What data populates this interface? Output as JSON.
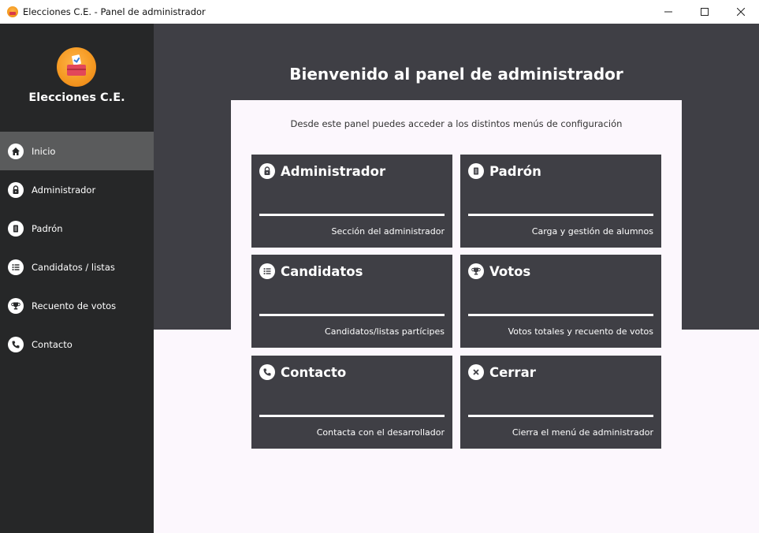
{
  "window": {
    "title": "Elecciones C.E. - Panel de administrador",
    "controls": [
      "minimize",
      "maximize",
      "close"
    ]
  },
  "sidebar": {
    "brand": "Elecciones C.E.",
    "logo_icon": "ballot-box-icon",
    "items": [
      {
        "label": "Inicio",
        "icon": "home-icon",
        "active": true
      },
      {
        "label": "Administrador",
        "icon": "lock-icon",
        "active": false
      },
      {
        "label": "Padrón",
        "icon": "document-icon",
        "active": false
      },
      {
        "label": "Candidatos / listas",
        "icon": "list-icon",
        "active": false
      },
      {
        "label": "Recuento de votos",
        "icon": "trophy-icon",
        "active": false
      },
      {
        "label": "Contacto",
        "icon": "phone-icon",
        "active": false
      }
    ]
  },
  "main": {
    "title": "Bienvenido al panel de administrador",
    "subtitle": "Desde este panel puedes acceder a los distintos menús de configuración",
    "cards": [
      {
        "title": "Administrador",
        "description": "Sección del administrador",
        "icon": "lock-icon"
      },
      {
        "title": "Padrón",
        "description": "Carga y gestión de alumnos",
        "icon": "document-icon"
      },
      {
        "title": "Candidatos",
        "description": "Candidatos/listas partícipes",
        "icon": "list-icon"
      },
      {
        "title": "Votos",
        "description": "Votos totales y recuento de votos",
        "icon": "trophy-icon"
      },
      {
        "title": "Contacto",
        "description": "Contacta con el desarrollador",
        "icon": "phone-icon"
      },
      {
        "title": "Cerrar",
        "description": "Cierra el menú de administrador",
        "icon": "close-circle-icon"
      }
    ]
  },
  "colors": {
    "sidebar_bg": "#262728",
    "sidebar_active": "#5a5b5c",
    "hero_bg": "#3f3f45",
    "card_bg": "#3f3f45",
    "page_bg": "#fcf7fd",
    "logo_orange": "#f59a23"
  }
}
